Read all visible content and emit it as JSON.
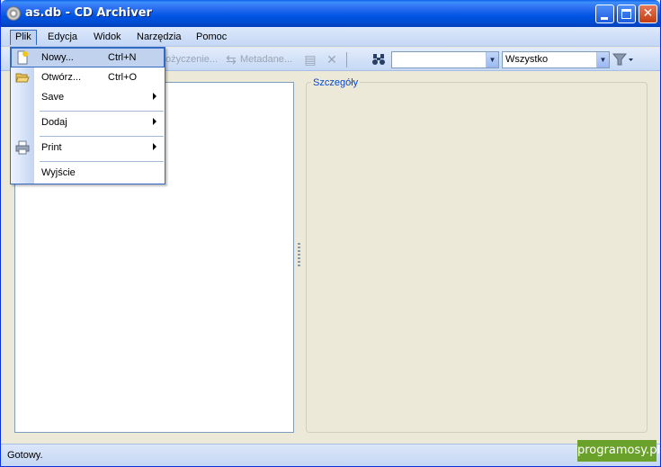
{
  "window": {
    "title": "as.db - CD Archiver"
  },
  "menubar": {
    "items": [
      "Plik",
      "Edycja",
      "Widok",
      "Narzędzia",
      "Pomoc"
    ]
  },
  "toolbar": {
    "loan_label": "ożyczenie...",
    "metadata_label": "Metadane...",
    "filter_value": "Wszystko"
  },
  "file_menu": {
    "items": [
      {
        "label": "Nowy...",
        "shortcut": "Ctrl+N"
      },
      {
        "label": "Otwórz...",
        "shortcut": "Ctrl+O"
      },
      {
        "label": "Save"
      },
      {
        "label": "Dodaj"
      },
      {
        "label": "Print"
      },
      {
        "label": "Wyjście"
      }
    ]
  },
  "details": {
    "title": "Szczegóły"
  },
  "statusbar": {
    "text": "Gotowy."
  },
  "watermark": {
    "text": "programosy.pl"
  },
  "colors": {
    "title_bar": "#0054e3",
    "menu_highlight": "#c1d2ee",
    "group_title": "#0046d5",
    "watermark": "#6aa12a"
  },
  "icons": [
    "app-icon",
    "new-file-icon",
    "open-folder-icon",
    "print-icon",
    "binoculars-icon",
    "filter-icon",
    "delete-icon"
  ]
}
